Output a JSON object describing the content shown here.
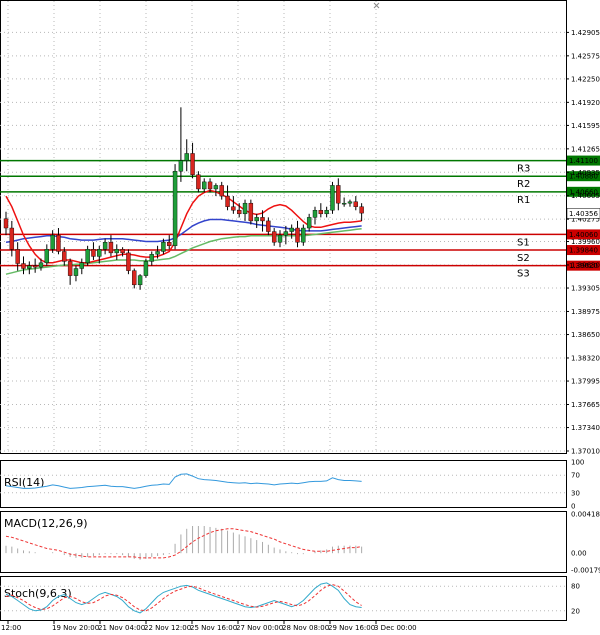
{
  "chart_data": {
    "type": "candlestick",
    "main": {
      "y_ticks": [
        "1.42905",
        "1.42575",
        "1.42250",
        "1.41920",
        "1.41595",
        "1.41265",
        "1.40935",
        "1.40605",
        "1.40275",
        "1.39960",
        "1.39630",
        "1.39305",
        "1.38975",
        "1.38650",
        "1.38320",
        "1.37995",
        "1.37665",
        "1.37340",
        "1.37010"
      ],
      "ylim": [
        1.3701,
        1.4315
      ],
      "price_tag": {
        "label": "1.40356",
        "value": 1.40356
      },
      "levels": [
        {
          "name": "R3",
          "value": 1.411,
          "label": "1.41100",
          "color": "#007700"
        },
        {
          "name": "R2",
          "value": 1.4088,
          "label": "1.40880",
          "color": "#007700"
        },
        {
          "name": "R1",
          "value": 1.4066,
          "label": "1.40660",
          "color": "#007700"
        },
        {
          "name": "S1",
          "value": 1.4006,
          "label": "1.40060",
          "color": "#cc0000"
        },
        {
          "name": "S2",
          "value": 1.3984,
          "label": "1.39840",
          "color": "#cc0000"
        },
        {
          "name": "S3",
          "value": 1.3962,
          "label": "1.39620",
          "color": "#cc0000"
        }
      ],
      "candles": [
        [
          1.4028,
          1.4038,
          1.4005,
          1.4015
        ],
        [
          1.4015,
          1.4025,
          1.3975,
          1.3985
        ],
        [
          1.3985,
          1.3995,
          1.3955,
          1.3965
        ],
        [
          1.3965,
          1.3975,
          1.395,
          1.3958
        ],
        [
          1.3958,
          1.3968,
          1.395,
          1.3962
        ],
        [
          1.3962,
          1.3972,
          1.3952,
          1.396
        ],
        [
          1.396,
          1.3972,
          1.3955,
          1.3966
        ],
        [
          1.3966,
          1.3992,
          1.3962,
          1.3985
        ],
        [
          1.3985,
          1.4012,
          1.398,
          1.4005
        ],
        [
          1.4005,
          1.4015,
          1.3978,
          1.3982
        ],
        [
          1.3982,
          1.3988,
          1.3962,
          1.3968
        ],
        [
          1.3968,
          1.3972,
          1.3935,
          1.3948
        ],
        [
          1.3948,
          1.3962,
          1.394,
          1.3958
        ],
        [
          1.3958,
          1.3972,
          1.395,
          1.3966
        ],
        [
          1.3966,
          1.399,
          1.3962,
          1.3985
        ],
        [
          1.3985,
          1.3995,
          1.397,
          1.3975
        ],
        [
          1.3975,
          1.399,
          1.3965,
          1.3985
        ],
        [
          1.3985,
          1.4,
          1.3978,
          1.3995
        ],
        [
          1.3995,
          1.4005,
          1.3975,
          1.398
        ],
        [
          1.398,
          1.3992,
          1.397,
          1.3985
        ],
        [
          1.3985,
          1.3988,
          1.3975,
          1.398
        ],
        [
          1.398,
          1.3985,
          1.395,
          1.3955
        ],
        [
          1.3955,
          1.3958,
          1.393,
          1.3935
        ],
        [
          1.3935,
          1.395,
          1.3928,
          1.3948
        ],
        [
          1.3948,
          1.3972,
          1.3945,
          1.3968
        ],
        [
          1.3968,
          1.3982,
          1.3962,
          1.3978
        ],
        [
          1.3978,
          1.399,
          1.3972,
          1.3982
        ],
        [
          1.3982,
          1.4,
          1.3978,
          1.3995
        ],
        [
          1.3995,
          1.4005,
          1.3985,
          1.399
        ],
        [
          1.399,
          1.4105,
          1.3985,
          1.4095
        ],
        [
          1.4095,
          1.4185,
          1.408,
          1.411
        ],
        [
          1.411,
          1.414,
          1.4095,
          1.412
        ],
        [
          1.412,
          1.4135,
          1.4085,
          1.409
        ],
        [
          1.409,
          1.4095,
          1.4065,
          1.407
        ],
        [
          1.407,
          1.4085,
          1.4065,
          1.408
        ],
        [
          1.408,
          1.4085,
          1.4065,
          1.407
        ],
        [
          1.407,
          1.4078,
          1.406,
          1.4075
        ],
        [
          1.4075,
          1.408,
          1.4055,
          1.406
        ],
        [
          1.406,
          1.4075,
          1.404,
          1.4045
        ],
        [
          1.4045,
          1.406,
          1.4035,
          1.404
        ],
        [
          1.404,
          1.405,
          1.403,
          1.4035
        ],
        [
          1.4035,
          1.4055,
          1.4025,
          1.405
        ],
        [
          1.405,
          1.4055,
          1.402,
          1.4025
        ],
        [
          1.4025,
          1.4035,
          1.4015,
          1.403
        ],
        [
          1.403,
          1.404,
          1.401,
          1.4025
        ],
        [
          1.4025,
          1.403,
          1.4005,
          1.401
        ],
        [
          1.401,
          1.4015,
          1.399,
          1.3995
        ],
        [
          1.3995,
          1.4012,
          1.3988,
          1.4005
        ],
        [
          1.4005,
          1.4018,
          1.3992,
          1.401
        ],
        [
          1.401,
          1.402,
          1.4,
          1.4015
        ],
        [
          1.4015,
          1.4025,
          1.3988,
          1.3995
        ],
        [
          1.3995,
          1.402,
          1.399,
          1.4015
        ],
        [
          1.4015,
          1.4035,
          1.401,
          1.403
        ],
        [
          1.403,
          1.4045,
          1.402,
          1.404
        ],
        [
          1.404,
          1.405,
          1.403,
          1.4035
        ],
        [
          1.4035,
          1.4045,
          1.403,
          1.404
        ],
        [
          1.404,
          1.408,
          1.4035,
          1.4075
        ],
        [
          1.4075,
          1.4085,
          1.404,
          1.405
        ],
        [
          1.405,
          1.4058,
          1.4045,
          1.405
        ],
        [
          1.405,
          1.4055,
          1.4045,
          1.4052
        ],
        [
          1.4052,
          1.406,
          1.404,
          1.4045
        ],
        [
          1.4045,
          1.405,
          1.4025,
          1.4036
        ]
      ],
      "sma_red": [
        1.406,
        1.4045,
        1.4025,
        1.4005,
        1.399,
        1.3978,
        1.397,
        1.3966,
        1.3966,
        1.3968,
        1.397,
        1.397,
        1.3968,
        1.3966,
        1.3966,
        1.3968,
        1.397,
        1.3972,
        1.3974,
        1.3976,
        1.3978,
        1.3978,
        1.3977,
        1.3975,
        1.3974,
        1.3974,
        1.3975,
        1.3978,
        1.3982,
        1.3995,
        1.4015,
        1.4035,
        1.405,
        1.406,
        1.4065,
        1.4068,
        1.4066,
        1.4062,
        1.4058,
        1.4052,
        1.4046,
        1.404,
        1.4036,
        1.4034,
        1.4036,
        1.4042,
        1.4046,
        1.4048,
        1.4046,
        1.404,
        1.4032,
        1.4024,
        1.4018,
        1.4016,
        1.4016,
        1.4018,
        1.402,
        1.4022,
        1.4023,
        1.4023,
        1.4024,
        1.4025
      ],
      "sma_blue": [
        1.3995,
        1.3996,
        1.3998,
        1.4,
        1.4001,
        1.4002,
        1.4003,
        1.4004,
        1.4004,
        1.4003,
        1.4002,
        1.4,
        1.3999,
        1.3998,
        1.3998,
        1.3998,
        1.3999,
        1.4,
        1.4,
        1.4,
        1.4,
        1.3999,
        1.3998,
        1.3997,
        1.3996,
        1.3996,
        1.3996,
        1.3997,
        1.3998,
        1.4001,
        1.4006,
        1.4012,
        1.4018,
        1.4022,
        1.4025,
        1.4027,
        1.4027,
        1.4027,
        1.4026,
        1.4025,
        1.4024,
        1.4023,
        1.4022,
        1.402,
        1.4019,
        1.4018,
        1.4017,
        1.4016,
        1.4015,
        1.4013,
        1.4012,
        1.4011,
        1.4011,
        1.4011,
        1.4011,
        1.4012,
        1.4013,
        1.4014,
        1.4015,
        1.4016,
        1.4017,
        1.4018
      ],
      "sma_green": [
        1.395,
        1.3952,
        1.3954,
        1.3956,
        1.3957,
        1.3958,
        1.3959,
        1.396,
        1.3961,
        1.3962,
        1.3963,
        1.3963,
        1.3964,
        1.3964,
        1.3965,
        1.3966,
        1.3967,
        1.3968,
        1.3969,
        1.397,
        1.397,
        1.397,
        1.397,
        1.3969,
        1.3969,
        1.3969,
        1.397,
        1.3971,
        1.3972,
        1.3975,
        1.3979,
        1.3983,
        1.3987,
        1.399,
        1.3993,
        1.3996,
        1.3998,
        1.4,
        1.4001,
        1.4002,
        1.4003,
        1.4003,
        1.4004,
        1.4004,
        1.4004,
        1.4004,
        1.4004,
        1.4004,
        1.4004,
        1.4004,
        1.4004,
        1.4004,
        1.4005,
        1.4006,
        1.4007,
        1.4008,
        1.4009,
        1.401,
        1.4011,
        1.4012,
        1.4013,
        1.4014
      ]
    },
    "rsi": {
      "title": "RSI(14)",
      "ticks": [
        "100",
        "70",
        "30",
        "0"
      ],
      "values": [
        46,
        44,
        42,
        40,
        40,
        41,
        43,
        45,
        48,
        46,
        43,
        40,
        41,
        42,
        44,
        45,
        46,
        47,
        45,
        44,
        44,
        42,
        40,
        42,
        45,
        47,
        48,
        50,
        49,
        66,
        72,
        73,
        68,
        62,
        60,
        59,
        58,
        56,
        54,
        53,
        52,
        53,
        51,
        52,
        51,
        50,
        48,
        50,
        51,
        52,
        51,
        53,
        55,
        56,
        56,
        57,
        64,
        60,
        58,
        58,
        57,
        56
      ]
    },
    "macd": {
      "title": "MACD(12,26,9)",
      "ticks": [
        "0.004181",
        "0.00",
        "-0.001794"
      ],
      "ylim": [
        -0.001794,
        0.004181
      ],
      "hist": [
        0.0008,
        0.0007,
        0.0005,
        0.0003,
        0.0002,
        0.0001,
        0.0,
        0.0,
        0.0001,
        0.0,
        -0.0002,
        -0.0004,
        -0.0005,
        -0.0005,
        -0.0004,
        -0.0003,
        -0.0002,
        -0.0001,
        -0.0001,
        -0.0001,
        -0.0002,
        -0.0004,
        -0.0006,
        -0.0007,
        -0.0006,
        -0.0004,
        -0.0003,
        -0.0002,
        -0.0001,
        0.001,
        0.002,
        0.0026,
        0.0029,
        0.0029,
        0.0029,
        0.0028,
        0.0027,
        0.0026,
        0.0024,
        0.0022,
        0.002,
        0.0018,
        0.0016,
        0.0014,
        0.0012,
        0.0009,
        0.0006,
        0.0004,
        0.0002,
        0.0001,
        -0.0001,
        -0.0001,
        0.0,
        0.0002,
        0.0003,
        0.0004,
        0.0007,
        0.0008,
        0.0008,
        0.0008,
        0.0008,
        0.0007
      ],
      "signal": [
        0.0018,
        0.0017,
        0.0015,
        0.0013,
        0.0011,
        0.0009,
        0.0007,
        0.0005,
        0.0004,
        0.0003,
        0.0001,
        -0.0001,
        -0.0002,
        -0.0003,
        -0.0004,
        -0.0004,
        -0.0004,
        -0.0004,
        -0.0004,
        -0.0004,
        -0.0004,
        -0.0004,
        -0.0004,
        -0.0005,
        -0.0005,
        -0.0005,
        -0.0005,
        -0.0005,
        -0.0004,
        -0.0002,
        0.0002,
        0.0007,
        0.0012,
        0.0016,
        0.0019,
        0.0022,
        0.0024,
        0.0025,
        0.0026,
        0.0026,
        0.0025,
        0.0024,
        0.0023,
        0.0021,
        0.0019,
        0.0017,
        0.0015,
        0.0012,
        0.001,
        0.0008,
        0.0006,
        0.0004,
        0.0003,
        0.0002,
        0.0002,
        0.0002,
        0.0003,
        0.0004,
        0.0005,
        0.0006,
        0.0006,
        0.0007
      ]
    },
    "stoch": {
      "title": "Stoch(9,6,3)",
      "ticks": [
        "80",
        "20"
      ],
      "k": [
        60,
        55,
        45,
        35,
        25,
        20,
        22,
        30,
        45,
        55,
        60,
        50,
        40,
        35,
        40,
        50,
        60,
        65,
        60,
        55,
        45,
        30,
        20,
        15,
        25,
        40,
        55,
        65,
        70,
        75,
        80,
        82,
        78,
        70,
        65,
        60,
        55,
        50,
        45,
        40,
        35,
        30,
        28,
        30,
        35,
        40,
        45,
        40,
        35,
        30,
        35,
        45,
        60,
        75,
        85,
        88,
        80,
        70,
        50,
        35,
        30,
        28
      ],
      "d": [
        55,
        58,
        52,
        45,
        35,
        28,
        23,
        25,
        32,
        42,
        52,
        55,
        50,
        42,
        38,
        40,
        47,
        56,
        60,
        58,
        52,
        42,
        30,
        22,
        20,
        27,
        38,
        50,
        60,
        68,
        73,
        78,
        80,
        76,
        70,
        65,
        60,
        55,
        50,
        45,
        40,
        35,
        31,
        29,
        31,
        35,
        40,
        43,
        40,
        35,
        32,
        36,
        45,
        57,
        70,
        80,
        84,
        80,
        68,
        55,
        42,
        33
      ]
    },
    "x_ticks": [
      "12:00",
      "19 Nov 20:00",
      "21 Nov 04:00",
      "22 Nov 12:00",
      "25 Nov 16:00",
      "27 Nov 00:00",
      "28 Nov 08:00",
      "29 Nov 16:00",
      "3 Dec 00:00"
    ]
  },
  "colors": {
    "bull": "#1f9e3a",
    "bear": "#d8261f",
    "sma_red": "#ee1111",
    "sma_blue": "#3344cc",
    "sma_green": "#66bb66",
    "rsi": "#3399dd",
    "macd_signal": "#ee3333",
    "macd_hist": "#aaaaaa",
    "stoch_k": "#33aacc",
    "stoch_d": "#ee3333",
    "grid": "#b8b8b8"
  }
}
